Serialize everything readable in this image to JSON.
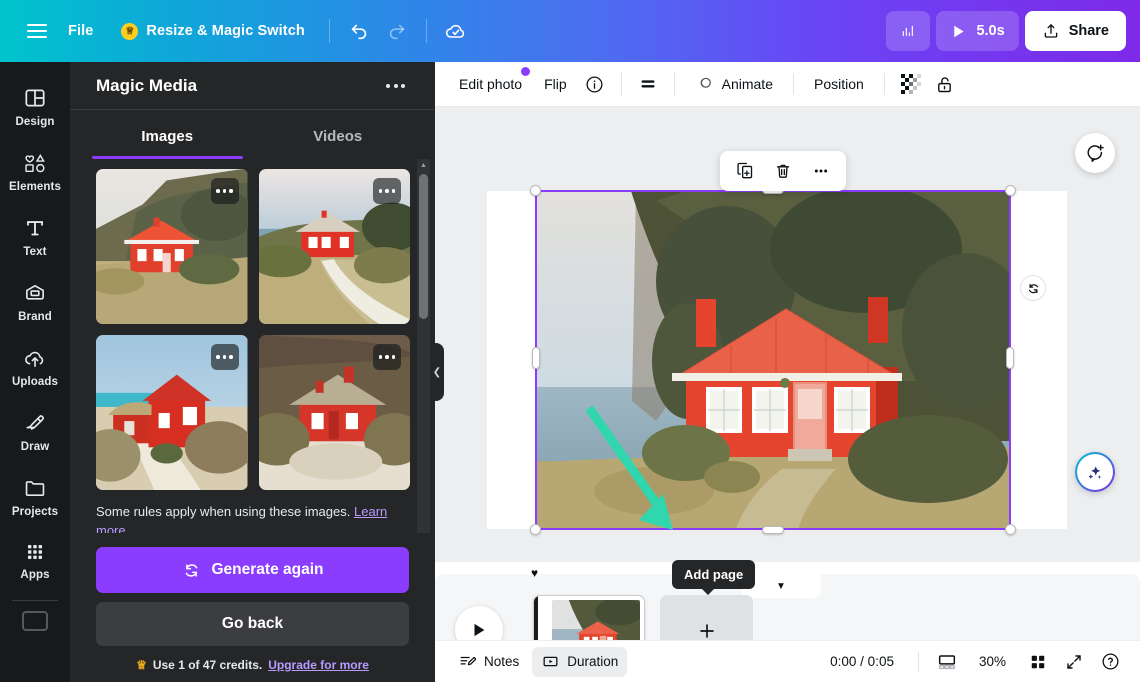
{
  "topbar": {
    "menu_icon": "hamburger-icon",
    "file_label": "File",
    "resize_label": "Resize & Magic Switch",
    "resize_badge_icon": "crown-icon",
    "undo_icon": "undo-icon",
    "redo_icon": "redo-icon",
    "cloud_saved_icon": "cloud-check-icon",
    "analytics_icon": "bar-chart-icon",
    "play_icon": "play-icon",
    "duration_label": "5.0s",
    "share_icon": "upload-icon",
    "share_label": "Share"
  },
  "rail": {
    "items": [
      {
        "label": "Design",
        "icon": "layout-icon"
      },
      {
        "label": "Elements",
        "icon": "shapes-icon"
      },
      {
        "label": "Text",
        "icon": "text-t-icon"
      },
      {
        "label": "Brand",
        "icon": "brand-wallet-icon"
      },
      {
        "label": "Uploads",
        "icon": "upload-cloud-icon"
      },
      {
        "label": "Draw",
        "icon": "pen-icon"
      },
      {
        "label": "Projects",
        "icon": "folder-icon"
      },
      {
        "label": "Apps",
        "icon": "grid-dots-icon"
      }
    ]
  },
  "panel": {
    "title": "Magic Media",
    "more_icon": "more-options-icon",
    "tabs": [
      {
        "label": "Images",
        "active": true
      },
      {
        "label": "Videos",
        "active": false
      }
    ],
    "results": [
      {
        "name": "red-cottage-cliff-sea",
        "alt": "Red cottage on grassy cliff by the sea"
      },
      {
        "name": "red-cottage-path-dunes",
        "alt": "Red cottage beside a sandy path in dunes"
      },
      {
        "name": "red-cottage-thatched-path",
        "alt": "Red thatched cottage along a sandy path"
      },
      {
        "name": "red-cottage-thatched-hill",
        "alt": "Red thatched cottage on a heather hillside"
      }
    ],
    "result_menu_icon": "more-options-icon",
    "rules_text": "Some rules apply when using these images.",
    "rules_link": "Learn more",
    "generate_icon": "refresh-icon",
    "generate_label": "Generate again",
    "go_back_label": "Go back",
    "credits_icon": "crown-icon",
    "credits_text": "Use 1 of 47 credits.",
    "credits_link": "Upgrade for more",
    "collapse_icon": "chevron-left-icon"
  },
  "editor_toolbar": {
    "edit_photo_label": "Edit photo",
    "edit_photo_badge": "new-dot",
    "flip_label": "Flip",
    "info_icon": "info-icon",
    "transparency_icon": "lines-icon",
    "animate_icon": "animate-icon",
    "animate_label": "Animate",
    "position_label": "Position",
    "transparency_grid_icon": "checkerboard-icon",
    "lock_icon": "lock-open-icon"
  },
  "canvas": {
    "selected_image_name": "red-cottage-cliff-sea",
    "float_toolbar": {
      "duplicate_icon": "duplicate-icon",
      "delete_icon": "trash-icon",
      "more_icon": "more-options-icon"
    },
    "rotate_icon": "rotate-icon",
    "comment_icon": "add-comment-icon",
    "magic_icon": "magic-sparkle-icon",
    "annotation_arrow": "teal-arrow"
  },
  "timeline": {
    "play_icon": "play-icon",
    "expand_icon": "chevron-down-icon",
    "timing_marker_icon": "timing-marker-icon",
    "page_duration": "5.0s",
    "add_page_icon": "plus-icon",
    "add_page_tooltip": "Add page"
  },
  "statusbar": {
    "notes_icon": "notes-icon",
    "notes_label": "Notes",
    "duration_icon": "duration-icon",
    "duration_label": "Duration",
    "time_display": "0:00 / 0:05",
    "timeline_view_icon": "timeline-view-icon",
    "zoom_level": "30%",
    "grid_view_icon": "grid-view-icon",
    "fullscreen_icon": "expand-icon",
    "help_icon": "help-icon"
  },
  "colors": {
    "brand_purple": "#8b3dff",
    "brand_teal": "#00c4cc",
    "panel_bg": "#252627",
    "rail_bg": "#18191b",
    "canvas_bg": "#eceef0",
    "annotation_arrow": "#2fd6ae"
  }
}
